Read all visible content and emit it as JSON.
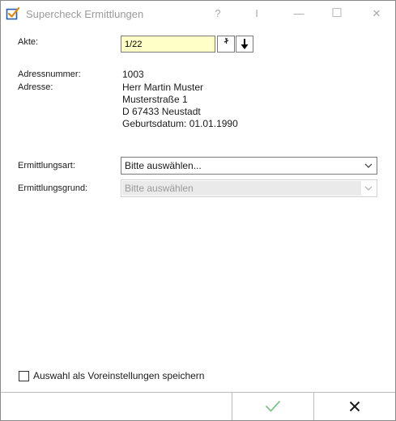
{
  "window": {
    "title": "Supercheck Ermittlungen",
    "help_glyph": "?",
    "cursor_glyph": "I",
    "minimize_glyph": "—",
    "maximize_glyph": "☐",
    "close_glyph": "✕"
  },
  "form": {
    "akte_label": "Akte:",
    "akte_value": "1/22",
    "adressnummer_label": "Adressnummer:",
    "adressnummer_value": "1003",
    "adresse_label": "Adresse:",
    "adresse_lines": [
      "Herr Martin Muster",
      "Musterstraße 1",
      "D 67433 Neustadt",
      "Geburtsdatum: 01.01.1990"
    ],
    "ermittlungsart_label": "Ermittlungsart:",
    "ermittlungsart_value": "Bitte auswählen...",
    "ermittlungsgrund_label": "Ermittlungsgrund:",
    "ermittlungsgrund_value": "Bitte auswählen"
  },
  "footer": {
    "save_defaults_label": "Auswahl als Voreinstellungen speichern",
    "save_defaults_checked": false
  },
  "colors": {
    "accent_orange": "#e8860a",
    "check_blue": "#2a5ca8",
    "ok_green": "#7cc48a",
    "akte_bg": "#ffffc8"
  }
}
